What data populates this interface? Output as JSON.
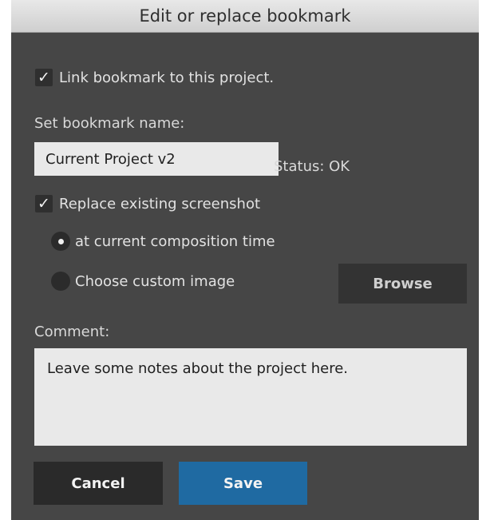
{
  "window": {
    "title": "Edit or replace bookmark"
  },
  "form": {
    "link_checkbox": {
      "label": "Link bookmark to this project.",
      "checked": true,
      "mark": "✓"
    },
    "name_label": "Set bookmark name:",
    "name_value": "Current Project v2",
    "status_text": "Status: OK",
    "replace_checkbox": {
      "label": "Replace existing screenshot",
      "checked": true,
      "mark": "✓"
    },
    "radio_options": [
      {
        "label": "at current composition time",
        "selected": true
      },
      {
        "label": "Choose custom image",
        "selected": false
      }
    ],
    "browse_label": "Browse",
    "comment_label": "Comment:",
    "comment_value": "Leave some notes about the project here."
  },
  "footer": {
    "cancel_label": "Cancel",
    "save_label": "Save"
  },
  "colors": {
    "panel_bg": "#464646",
    "save_button": "#1f6aa2",
    "cancel_button": "#2a2a2a"
  }
}
